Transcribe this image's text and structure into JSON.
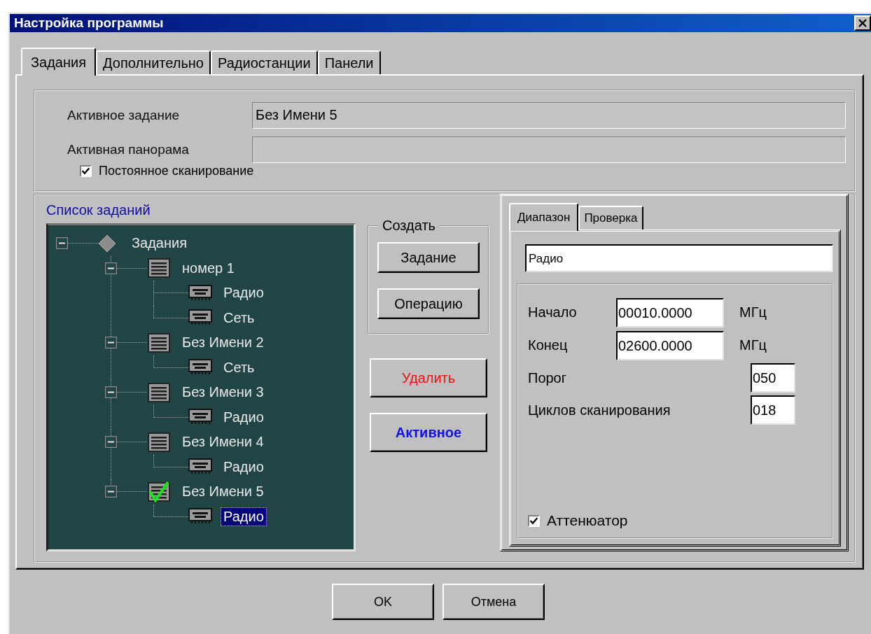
{
  "window": {
    "title": "Настройка программы"
  },
  "tabs": [
    {
      "label": "Задания",
      "selected": true
    },
    {
      "label": "Дополнительно",
      "selected": false
    },
    {
      "label": "Радиостанции",
      "selected": false
    },
    {
      "label": "Панели",
      "selected": false
    }
  ],
  "info_fields": [
    {
      "label": "Активное задание",
      "value": "Без Имени 5"
    },
    {
      "label": "Активная панорама"
    }
  ],
  "continuous_scan": {
    "label": "Постоянное сканирование",
    "checked": true
  },
  "task_list": {
    "title": "Список заданий",
    "tree": {
      "label": "Задания",
      "kind": "root",
      "expanded": true,
      "children": [
        {
          "label": "номер 1",
          "kind": "task",
          "expanded": true,
          "active": false,
          "children": [
            {
              "label": "Радио",
              "kind": "operation",
              "selected": false
            },
            {
              "label": "Сеть",
              "kind": "operation",
              "selected": false
            }
          ]
        },
        {
          "label": "Без Имени 2",
          "kind": "task",
          "expanded": true,
          "active": false,
          "children": [
            {
              "label": "Сеть",
              "kind": "operation",
              "selected": false
            }
          ]
        },
        {
          "label": "Без Имени 3",
          "kind": "task",
          "expanded": true,
          "active": false,
          "children": [
            {
              "label": "Радио",
              "kind": "operation",
              "selected": false
            }
          ]
        },
        {
          "label": "Без Имени 4",
          "kind": "task",
          "expanded": true,
          "active": false,
          "children": [
            {
              "label": "Радио",
              "kind": "operation",
              "selected": false
            }
          ]
        },
        {
          "label": "Без Имени 5",
          "kind": "task",
          "expanded": true,
          "active": true,
          "children": [
            {
              "label": "Радио",
              "kind": "operation",
              "selected": true
            }
          ]
        }
      ]
    }
  },
  "create_group": {
    "title": "Создать",
    "buttons": [
      "Задание",
      "Операцию"
    ]
  },
  "action_buttons": [
    {
      "label": "Удалить",
      "kind": "delete"
    },
    {
      "label": "Активное",
      "kind": "activate"
    }
  ],
  "detail": {
    "tabs": [
      {
        "label": "Диапазон",
        "selected": true
      },
      {
        "label": "Проверка",
        "selected": false
      }
    ],
    "name": "Радио",
    "fields": [
      {
        "label": "Начало",
        "value": "00010.0000",
        "unit": "МГц",
        "kind": "wide"
      },
      {
        "label": "Конец",
        "value": "02600.0000",
        "unit": "МГц",
        "kind": "wide"
      },
      {
        "label": "Порог",
        "value": "050",
        "kind": "short"
      },
      {
        "label": "Циклов сканирования",
        "value": "018",
        "kind": "short"
      }
    ],
    "attenuator": {
      "label": "Аттенюатор",
      "checked": true
    }
  },
  "footer_buttons": [
    "OK",
    "Отмена"
  ]
}
